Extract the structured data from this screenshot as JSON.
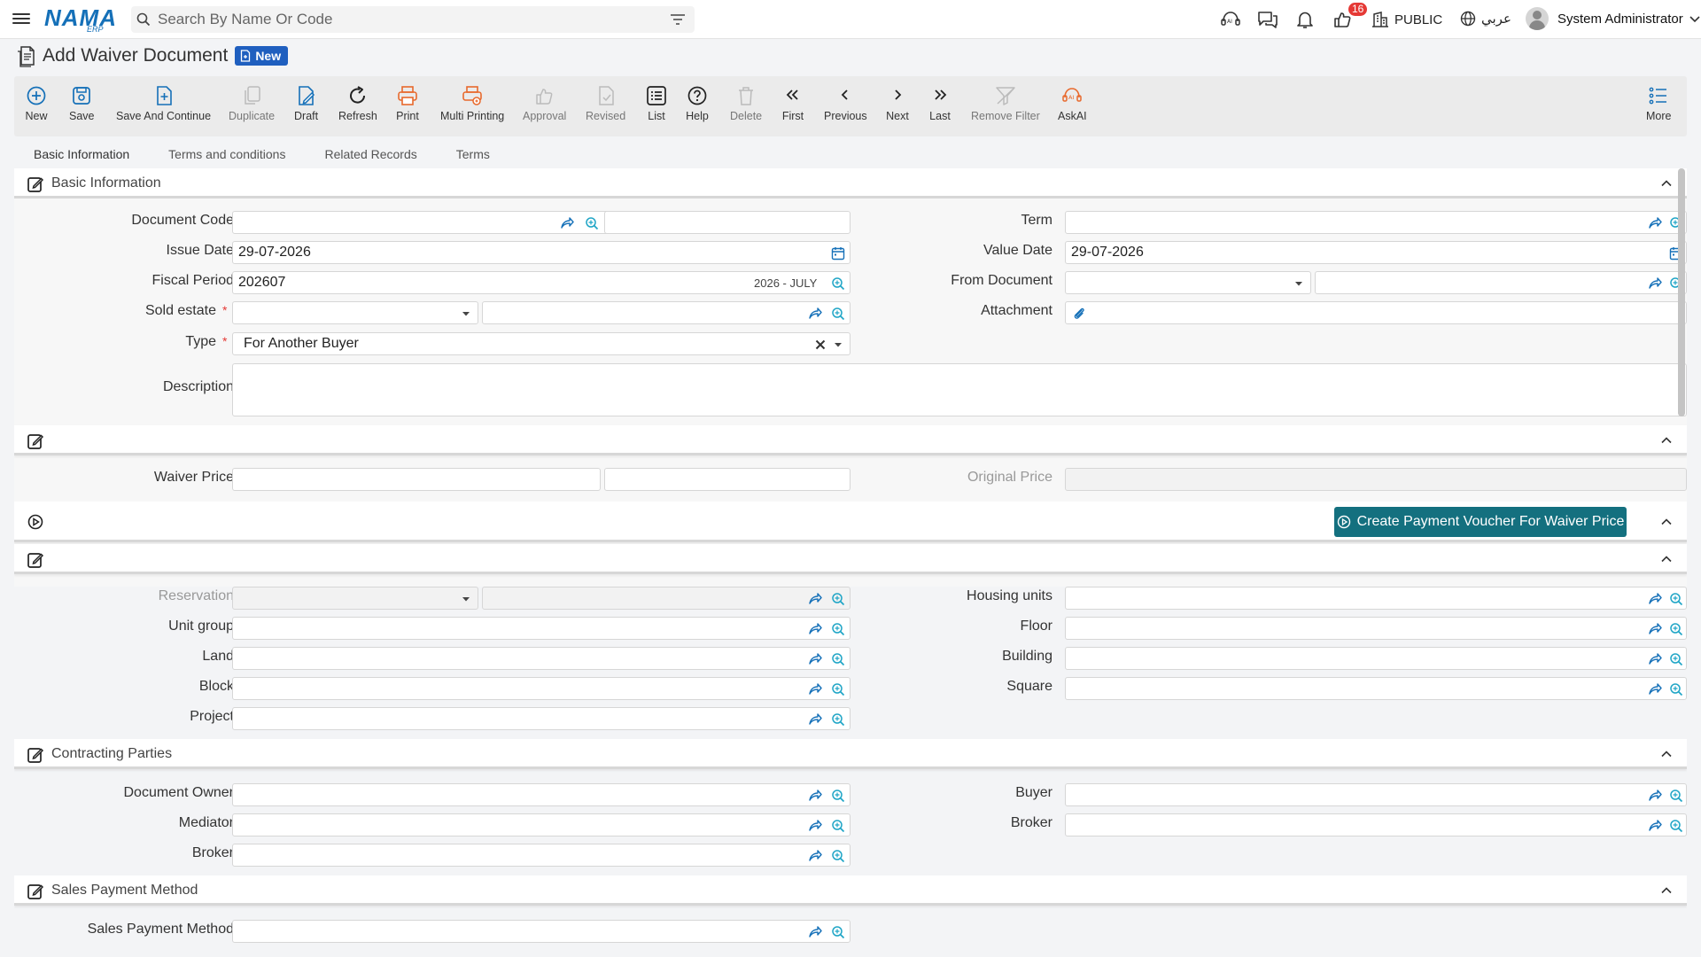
{
  "topbar": {
    "search_placeholder": "Search By Name Or Code",
    "logo_text": "NAMA",
    "logo_sub": "ERP",
    "notification_count": "16",
    "branch": "PUBLIC",
    "language": "عربي",
    "user_name": "System Administrator"
  },
  "page": {
    "title": "Add Waiver Document",
    "badge": "New"
  },
  "toolbar": [
    {
      "label": "New"
    },
    {
      "label": "Save"
    },
    {
      "label": "Save And Continue"
    },
    {
      "label": "Duplicate"
    },
    {
      "label": "Draft"
    },
    {
      "label": "Refresh"
    },
    {
      "label": "Print"
    },
    {
      "label": "Multi Printing"
    },
    {
      "label": "Approval"
    },
    {
      "label": "Revised"
    },
    {
      "label": "List"
    },
    {
      "label": "Help"
    },
    {
      "label": "Delete"
    },
    {
      "label": "First"
    },
    {
      "label": "Previous"
    },
    {
      "label": "Next"
    },
    {
      "label": "Last"
    },
    {
      "label": "Remove Filter"
    },
    {
      "label": "AskAI"
    },
    {
      "label": "More"
    }
  ],
  "tabs": [
    "Basic Information",
    "Terms and conditions",
    "Related Records",
    "Terms"
  ],
  "basic": {
    "title": "Basic Information",
    "document_code": "Document Code",
    "term": "Term",
    "issue_date": "Issue Date",
    "issue_date_value": "29-07-2026",
    "value_date": "Value Date",
    "value_date_value": "29-07-2026",
    "fiscal_period": "Fiscal Period",
    "fiscal_period_value": "202607",
    "fiscal_period_text": "2026 - JULY",
    "from_document": "From Document",
    "sold_estate": "Sold estate",
    "attachment": "Attachment",
    "type": "Type",
    "type_value": "For Another Buyer",
    "description": "Description",
    "required_mark": "*"
  },
  "price": {
    "waiver_price": "Waiver Price",
    "original_price": "Original Price",
    "action_button": "Create Payment Voucher For Waiver Price"
  },
  "unit": {
    "reservation": "Reservation",
    "housing_units": "Housing units",
    "unit_group": "Unit group",
    "floor": "Floor",
    "land": "Land",
    "building": "Building",
    "block": "Block",
    "square": "Square",
    "project": "Project"
  },
  "parties": {
    "title": "Contracting Parties",
    "document_owner": "Document Owner",
    "buyer": "Buyer",
    "mediator": "Mediator",
    "broker_right": "Broker",
    "broker_left": "Broker"
  },
  "payment": {
    "title": "Sales Payment Method",
    "sales_payment_method": "Sales Payment Method"
  },
  "colors": {
    "brand": "#1570b8",
    "action": "#14707f",
    "badge": "#1f5fbf",
    "orange": "#e8692c",
    "required": "#e53935"
  }
}
